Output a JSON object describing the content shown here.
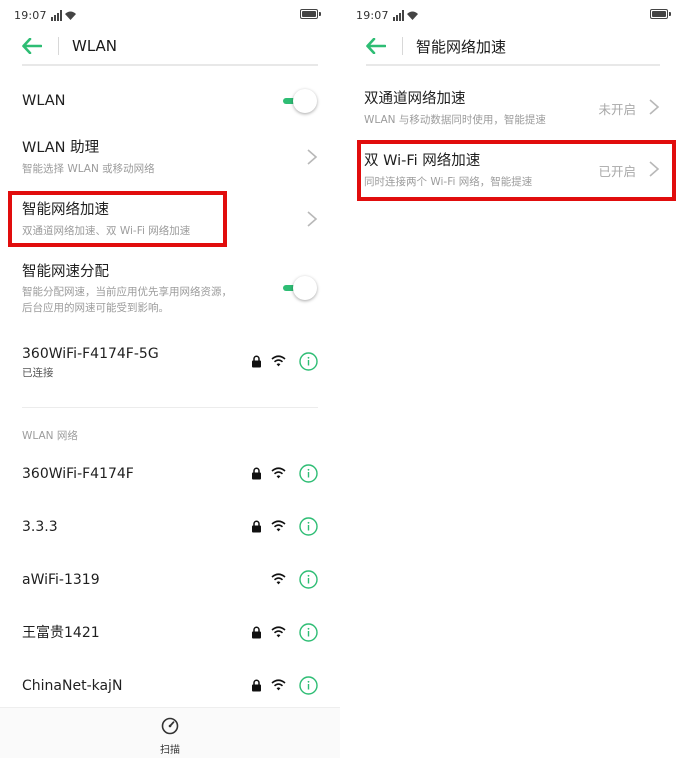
{
  "left_screen": {
    "status": {
      "time": "19:07"
    },
    "title": "WLAN",
    "wlan_toggle": {
      "label": "WLAN",
      "on": true
    },
    "assistant": {
      "title": "WLAN 助理",
      "subtitle": "智能选择 WLAN 或移动网络"
    },
    "smart_accel": {
      "title": "智能网络加速",
      "subtitle": "双通道网络加速、双 Wi-Fi 网络加速"
    },
    "smart_alloc": {
      "title": "智能网速分配",
      "subtitle_line1": "智能分配网速，当前应用优先享用网络资源，",
      "subtitle_line2": "后台应用的网速可能受到影响。",
      "on": true
    },
    "connected": {
      "ssid": "360WiFi-F4174F-5G",
      "status": "已连接",
      "locked": true
    },
    "section_label": "WLAN 网络",
    "networks": [
      {
        "ssid": "360WiFi-F4174F",
        "locked": true
      },
      {
        "ssid": "3.3.3",
        "locked": true
      },
      {
        "ssid": "aWiFi-1319",
        "locked": false
      },
      {
        "ssid": "王富贵1421",
        "locked": true
      },
      {
        "ssid": "ChinaNet-kajN",
        "locked": true
      }
    ],
    "bottom": {
      "scan_label": "扫描"
    }
  },
  "right_screen": {
    "status": {
      "time": "19:07"
    },
    "title": "智能网络加速",
    "items": [
      {
        "title": "双通道网络加速",
        "subtitle": "WLAN 与移动数据同时使用，智能提速",
        "status": "未开启"
      },
      {
        "title": "双 Wi-Fi 网络加速",
        "subtitle": "同时连接两个 Wi-Fi 网络，智能提速",
        "status": "已开启"
      }
    ]
  },
  "colors": {
    "accent": "#2ebd74",
    "highlight": "#e10d0d",
    "text_secondary": "#9c9c9c"
  },
  "icons": [
    "back-arrow-icon",
    "chevron-right-icon",
    "lock-icon",
    "wifi-icon",
    "info-icon",
    "scan-icon",
    "battery-icon",
    "signal-icon"
  ]
}
